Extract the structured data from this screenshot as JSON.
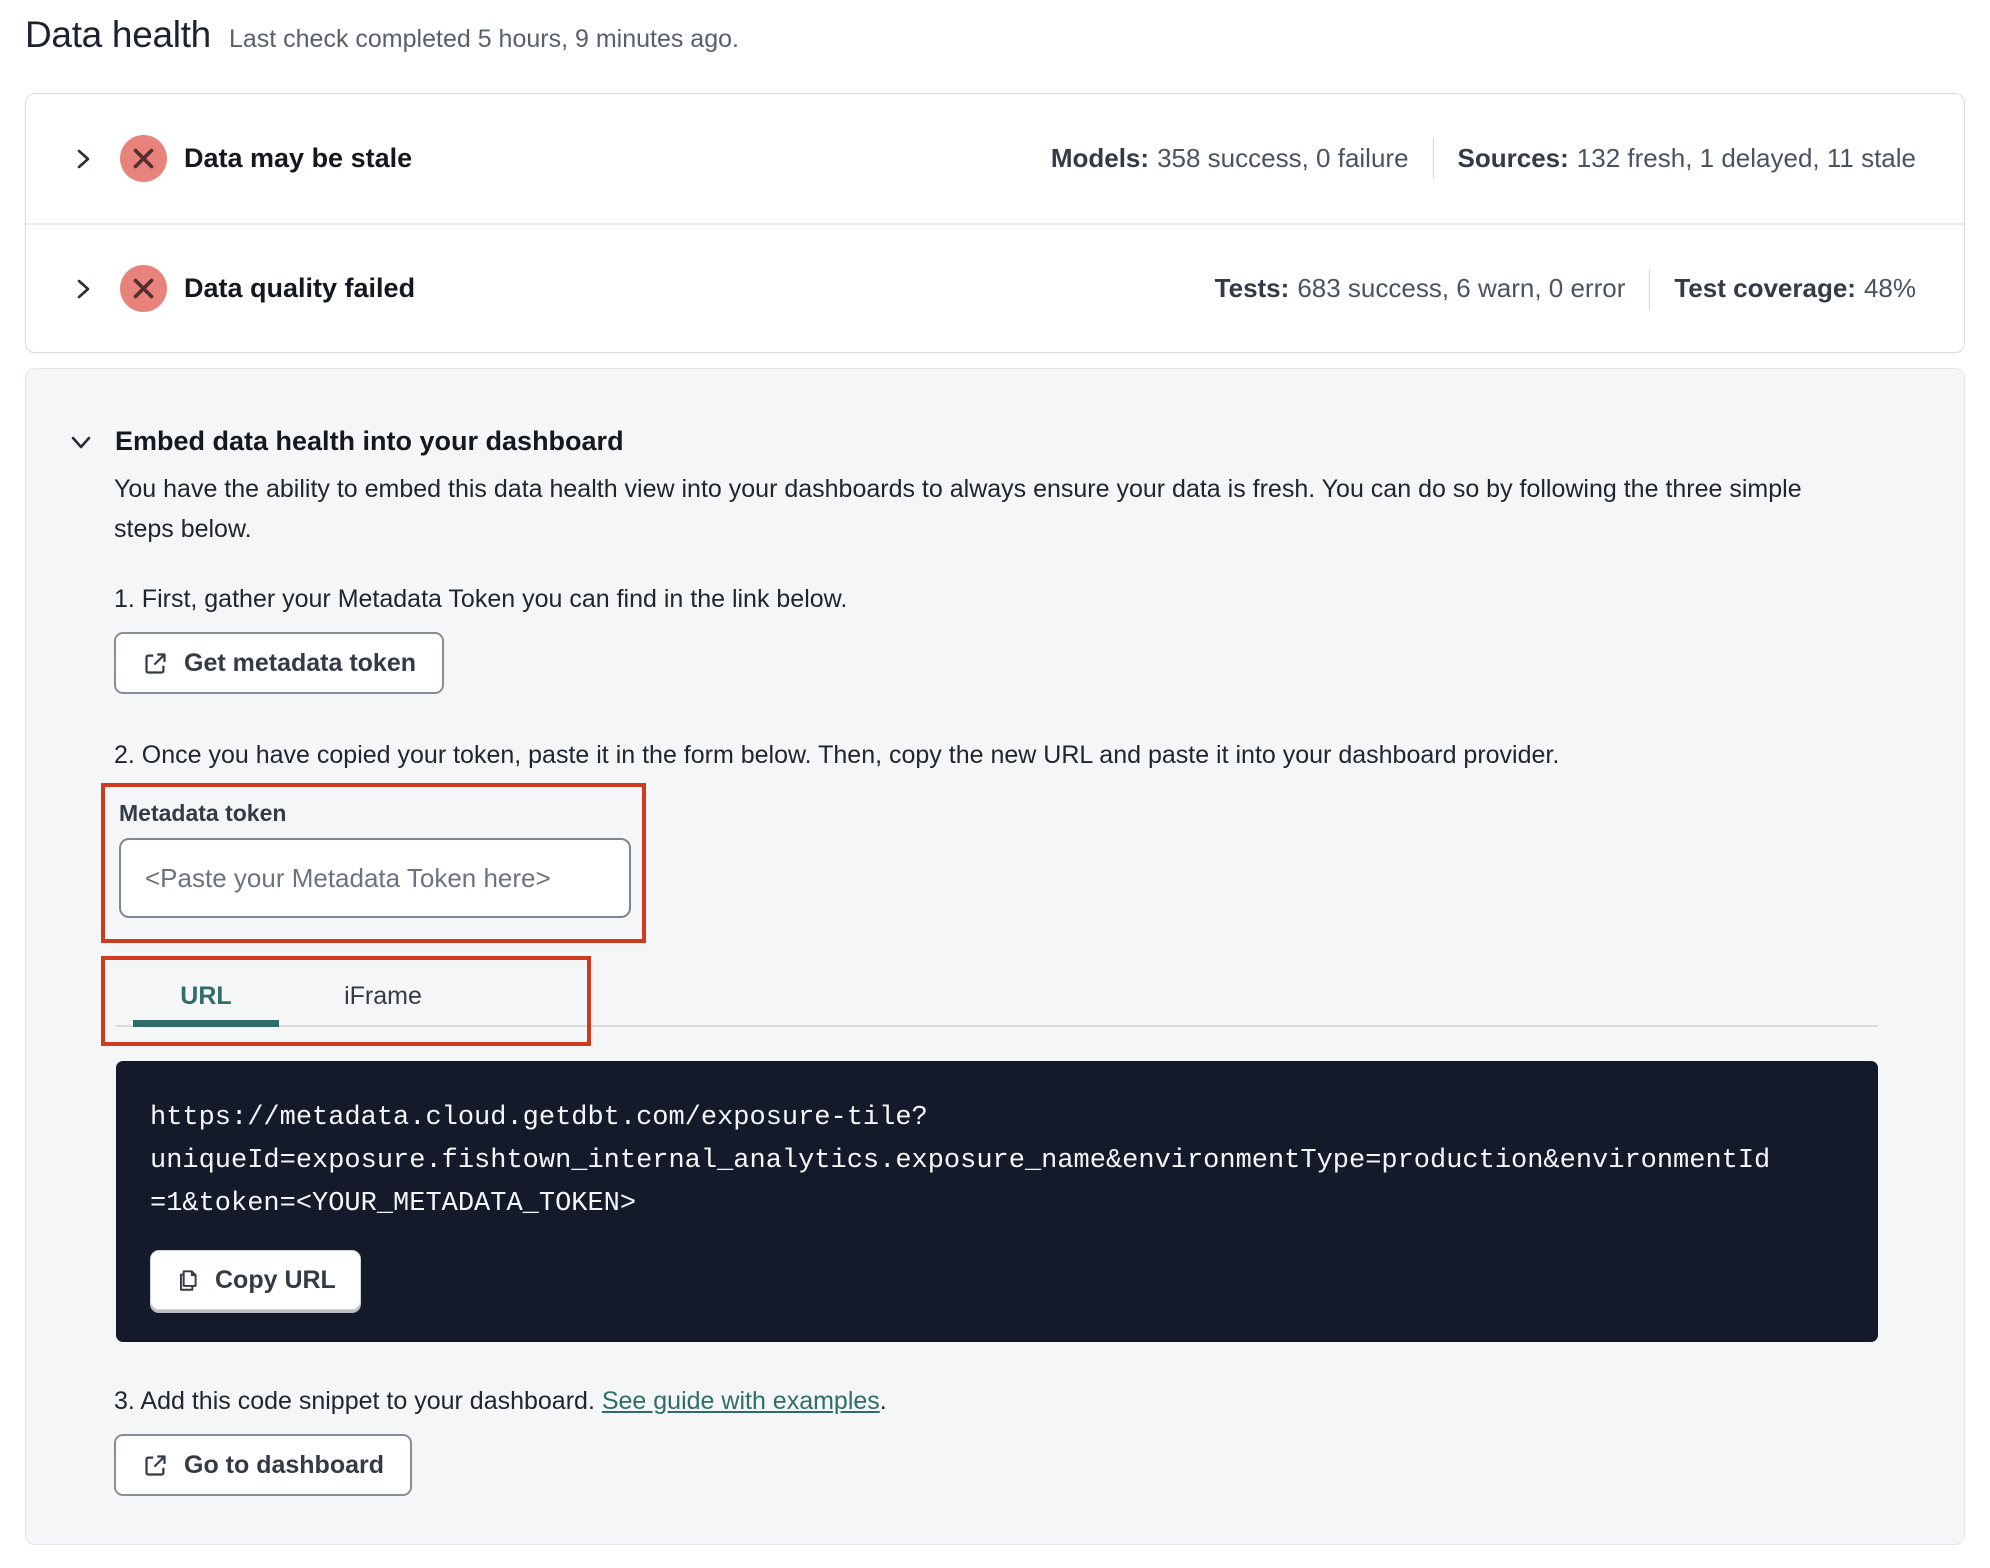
{
  "header": {
    "title": "Data health",
    "subtitle": "Last check completed 5 hours, 9 minutes ago."
  },
  "rows": [
    {
      "title": "Data may be stale",
      "status_icon": "error-x-circle",
      "stats": [
        {
          "label": "Models:",
          "value": "358 success, 0 failure"
        },
        {
          "label": "Sources:",
          "value": "132 fresh, 1 delayed, 11 stale"
        }
      ]
    },
    {
      "title": "Data quality failed",
      "status_icon": "error-x-circle",
      "stats": [
        {
          "label": "Tests:",
          "value": "683 success, 6 warn, 0 error"
        },
        {
          "label": "Test coverage:",
          "value": "48%"
        }
      ]
    }
  ],
  "embed": {
    "heading": "Embed data health into your dashboard",
    "description": "You have the ability to embed this data health view into your dashboards to always ensure your data is fresh. You can do so by following the three simple steps below.",
    "step1": {
      "text": "1. First, gather your Metadata Token you can find in the link below.",
      "button_label": "Get metadata token",
      "button_icon": "external-link-icon"
    },
    "step2": {
      "text": "2. Once you have copied your token, paste it in the form below. Then, copy the new URL and paste it into your dashboard provider."
    },
    "token": {
      "label": "Metadata token",
      "value": "",
      "placeholder": "<Paste your Metadata Token here>"
    },
    "tabs": {
      "url": "URL",
      "iframe": "iFrame",
      "active": "URL"
    },
    "code": {
      "lines": [
        "https://metadata.cloud.getdbt.com/exposure-tile?",
        "uniqueId=exposure.fishtown_internal_analytics.exposure_name&environmentType=production&environmentId",
        "=1&token=<YOUR_METADATA_TOKEN>"
      ],
      "url": "https://metadata.cloud.getdbt.com/exposure-tile?uniqueId=exposure.fishtown_internal_analytics.exposure_name&environmentType=production&environmentId=1&token=<YOUR_METADATA_TOKEN>",
      "copy_label": "Copy URL",
      "copy_icon": "copy-icon"
    },
    "step3": {
      "text_before": "3. Add this code snippet to your dashboard. ",
      "link_text": "See guide with examples",
      "text_after": ".",
      "button_label": "Go to dashboard",
      "button_icon": "external-link-icon"
    }
  },
  "colors": {
    "accent_teal": "#2f6d68",
    "error_badge_fill": "#e8837b",
    "error_badge_glyph": "#4e2d33",
    "annotation_red": "#ce3b1f",
    "code_block_bg": "#141a2a",
    "card_bg": "#ffffff",
    "embed_card_bg": "#f5f6f8"
  }
}
